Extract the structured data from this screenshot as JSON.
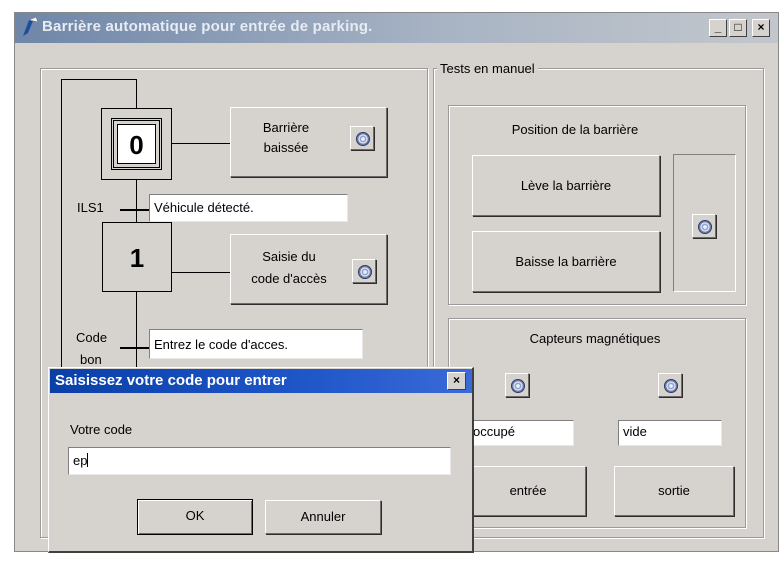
{
  "window": {
    "title": "Barrière automatique pour entrée de parking.",
    "buttons": {
      "minimize": "_",
      "maximize": "□",
      "close": "×"
    }
  },
  "grafcet": {
    "step0": {
      "number": "0",
      "action_line1": "Barrière",
      "action_line2": "baissée"
    },
    "transition1": {
      "label": "ILS1",
      "text": "Véhicule détecté."
    },
    "step1": {
      "number": "1",
      "action_line1": "Saisie du",
      "action_line2": "code d'accès"
    },
    "transition2": {
      "label_line1": "Code",
      "label_line2": "bon",
      "text": "Entrez le code d'acces."
    }
  },
  "manual_tests": {
    "title": "Tests en manuel",
    "position_group": {
      "title": "Position de la barrière",
      "raise_button": "Lève la barrière",
      "lower_button": "Baisse la barrière"
    },
    "sensors_group": {
      "title": "Capteurs magnétiques",
      "left_field": "occupé",
      "right_field": "vide",
      "entry_button": "entrée",
      "exit_button": "sortie"
    }
  },
  "dialog": {
    "title": "Saisissez votre code pour entrer",
    "close": "×",
    "prompt": "Votre code",
    "input_value": "ep",
    "ok_button": "OK",
    "cancel_button": "Annuler"
  },
  "colors": {
    "window_bg": "#d6d3ce",
    "dialog_title_bg": "#1f56c8",
    "led": "#7890c8"
  }
}
